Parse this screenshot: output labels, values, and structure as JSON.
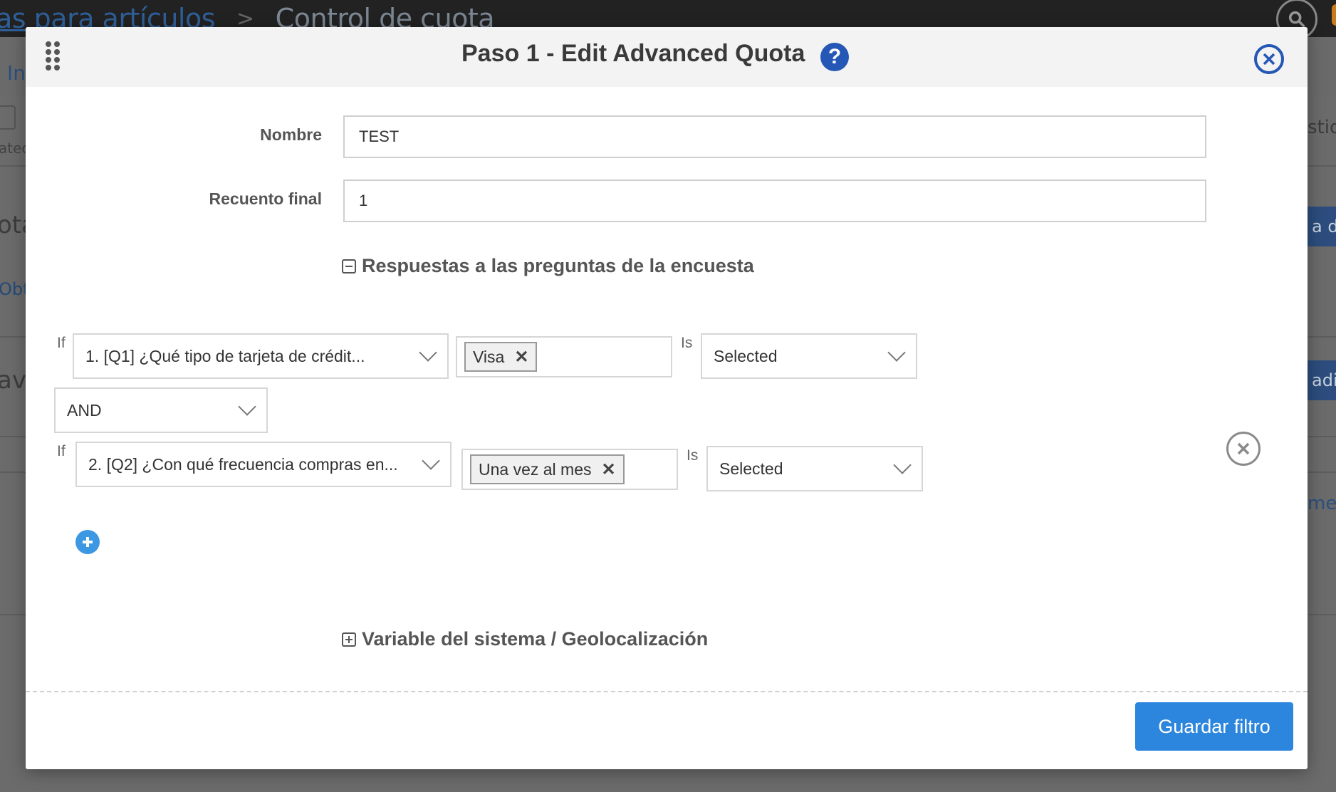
{
  "background": {
    "breadcrumb": {
      "crumb1": "as para artículos",
      "separator": ">",
      "crumb2": "Control de cuota"
    },
    "fragments": {
      "left_tab": "In",
      "left_home_label": "atec",
      "left_heading": "ota",
      "left_obt": "Obt",
      "left_ava": "ava",
      "right_top": "stio",
      "right_btn1": "a de",
      "right_btn2": "adi",
      "right_me": "me"
    }
  },
  "modal": {
    "title": "Paso 1 - Edit Advanced Quota",
    "help_glyph": "?",
    "fields": {
      "nombre_label": "Nombre",
      "nombre_value": "TEST",
      "recuento_label": "Recuento final",
      "recuento_value": "1"
    },
    "section_survey": "Respuestas a las preguntas de la encuesta",
    "conditions": [
      {
        "if_label": "If",
        "question": "1. [Q1] ¿Qué tipo de tarjeta de crédit...",
        "tag": "Visa",
        "is_label": "Is",
        "state": "Selected"
      },
      {
        "if_label": "If",
        "question": "2. [Q2] ¿Con qué frecuencia compras en...",
        "tag": "Una vez al mes",
        "is_label": "Is",
        "state": "Selected"
      }
    ],
    "operator": "AND",
    "section_system": "Variable del sistema / Geolocalización",
    "save_button": "Guardar filtro"
  },
  "colors": {
    "primary_blue": "#2d86dd",
    "title_icon_blue": "#2457b6",
    "add_icon_blue": "#3d98e3"
  }
}
